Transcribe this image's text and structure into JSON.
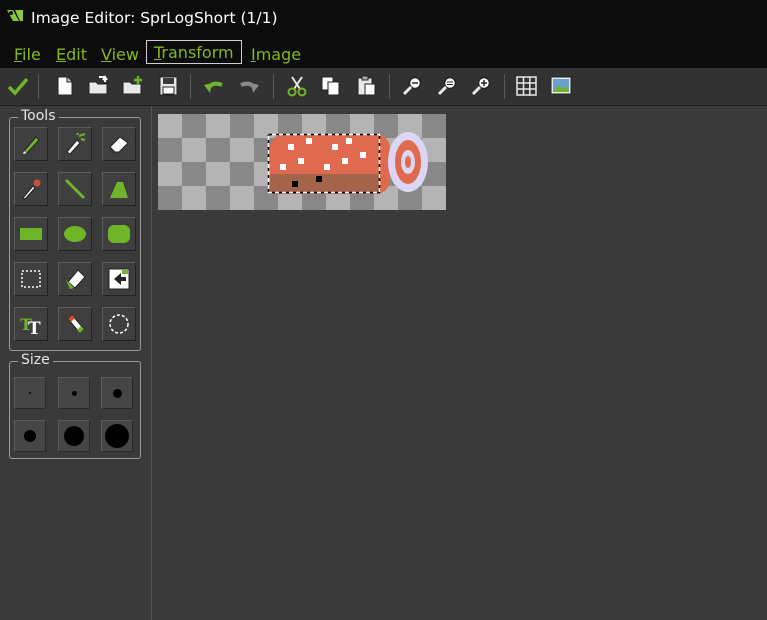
{
  "window": {
    "title": "Image Editor: SprLogShort (1/1)",
    "logo_icon": "gamemaker-logo-icon"
  },
  "menu": [
    {
      "label": "File",
      "key": "file"
    },
    {
      "label": "Edit",
      "key": "edit"
    },
    {
      "label": "View",
      "key": "view"
    },
    {
      "label": "Transform",
      "key": "transform",
      "active": true
    },
    {
      "label": "Image",
      "key": "image"
    }
  ],
  "toolbar": [
    {
      "icon": "checkmark-icon",
      "name": "confirm-button"
    },
    {
      "icon": "new-file-icon",
      "name": "new-image-button"
    },
    {
      "icon": "open-folder-icon",
      "name": "open-image-button"
    },
    {
      "icon": "add-folder-icon",
      "name": "add-image-button"
    },
    {
      "icon": "save-icon",
      "name": "save-button"
    },
    {
      "icon": "undo-icon",
      "name": "undo-button"
    },
    {
      "icon": "redo-icon",
      "name": "redo-button"
    },
    {
      "icon": "scissors-icon",
      "name": "cut-button"
    },
    {
      "icon": "copy-icon",
      "name": "copy-button"
    },
    {
      "icon": "paste-icon",
      "name": "paste-button"
    },
    {
      "icon": "zoom-out-icon",
      "name": "zoom-out-button"
    },
    {
      "icon": "zoom-reset-icon",
      "name": "zoom-reset-button"
    },
    {
      "icon": "zoom-in-icon",
      "name": "zoom-in-button"
    },
    {
      "icon": "grid-icon",
      "name": "toggle-grid-button"
    },
    {
      "icon": "image-preview-icon",
      "name": "preview-button"
    }
  ],
  "tools": {
    "label": "Tools",
    "items": [
      "pencil-icon",
      "spray-icon",
      "eraser-icon",
      "color-picker-icon",
      "line-icon",
      "polygon-icon",
      "rectangle-icon",
      "ellipse-icon",
      "rounded-rectangle-icon",
      "select-region-icon",
      "magic-wand-icon",
      "paste-selection-icon",
      "text-icon",
      "color-replace-icon",
      "lasso-icon"
    ]
  },
  "size": {
    "label": "Size",
    "items": [
      "size-1-icon",
      "size-2-icon",
      "size-3-icon",
      "size-4-icon",
      "size-5-icon",
      "size-6-icon"
    ]
  },
  "colors": {
    "menu_accent": "#84b81b",
    "log_red": "#e06a4f",
    "log_brown": "#a4644a",
    "log_highlight": "#ffffff",
    "ring_lavender": "#dad6f4",
    "checker_light": "#b4b4b4",
    "checker_dark": "#888888"
  }
}
